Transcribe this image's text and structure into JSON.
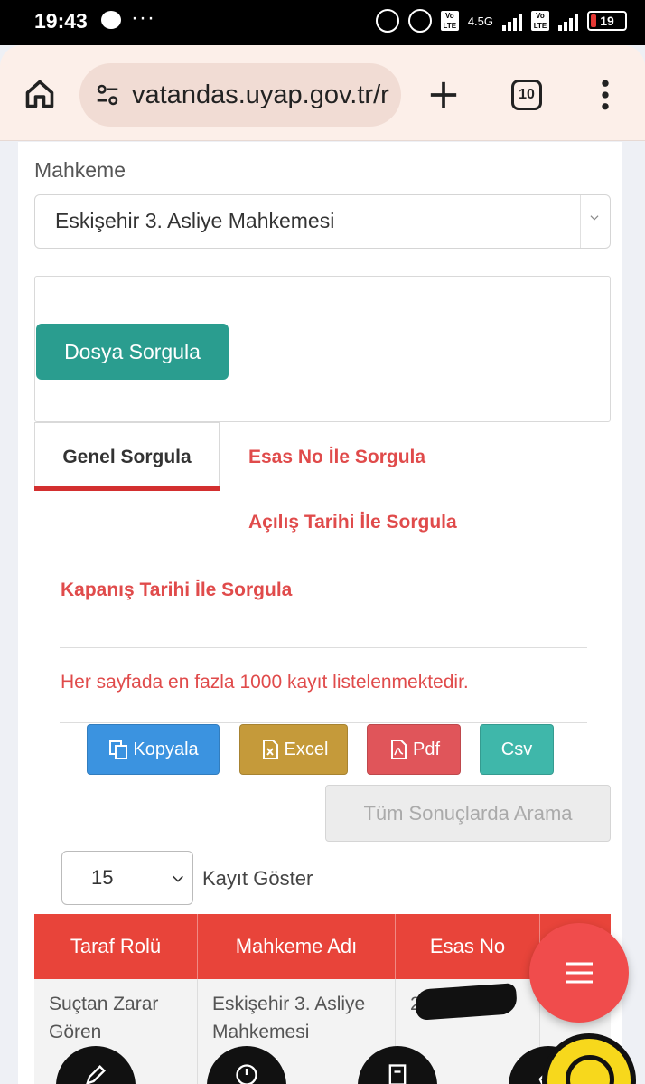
{
  "status_bar": {
    "time": "19:43",
    "network": "4.5G",
    "battery": "19"
  },
  "browser": {
    "url": "vatandas.uyap.gov.tr/r",
    "tab_count": "10"
  },
  "form": {
    "mahkeme_label": "Mahkeme",
    "mahkeme_value": "Eskişehir 3. Asliye Mahkemesi",
    "dosya_button": "Dosya Sorgula"
  },
  "tabs": {
    "genel": "Genel Sorgula",
    "esas": "Esas No İle Sorgula",
    "acilis": "Açılış Tarihi İle Sorgula",
    "kapanis": "Kapanış Tarihi İle Sorgula"
  },
  "info_text": "Her sayfada en fazla 1000 kayıt listelenmektedir.",
  "export": {
    "kopyala": "Kopyala",
    "excel": "Excel",
    "pdf": "Pdf",
    "csv": "Csv"
  },
  "search_all": "Tüm Sonuçlarda Arama",
  "page_size": {
    "value": "15",
    "label": "Kayıt Göster"
  },
  "table": {
    "headers": [
      "Taraf Rolü",
      "Mahkeme Adı",
      "Esas No",
      ""
    ],
    "rows": [
      [
        "Suçtan Zarar Gören",
        "Eskişehir 3. Asliye Mahkemesi",
        "2",
        ""
      ]
    ]
  },
  "colors": {
    "primary_teal": "#2a9d8f",
    "accent_red": "#e8443a",
    "link_red": "#e04b4b"
  }
}
